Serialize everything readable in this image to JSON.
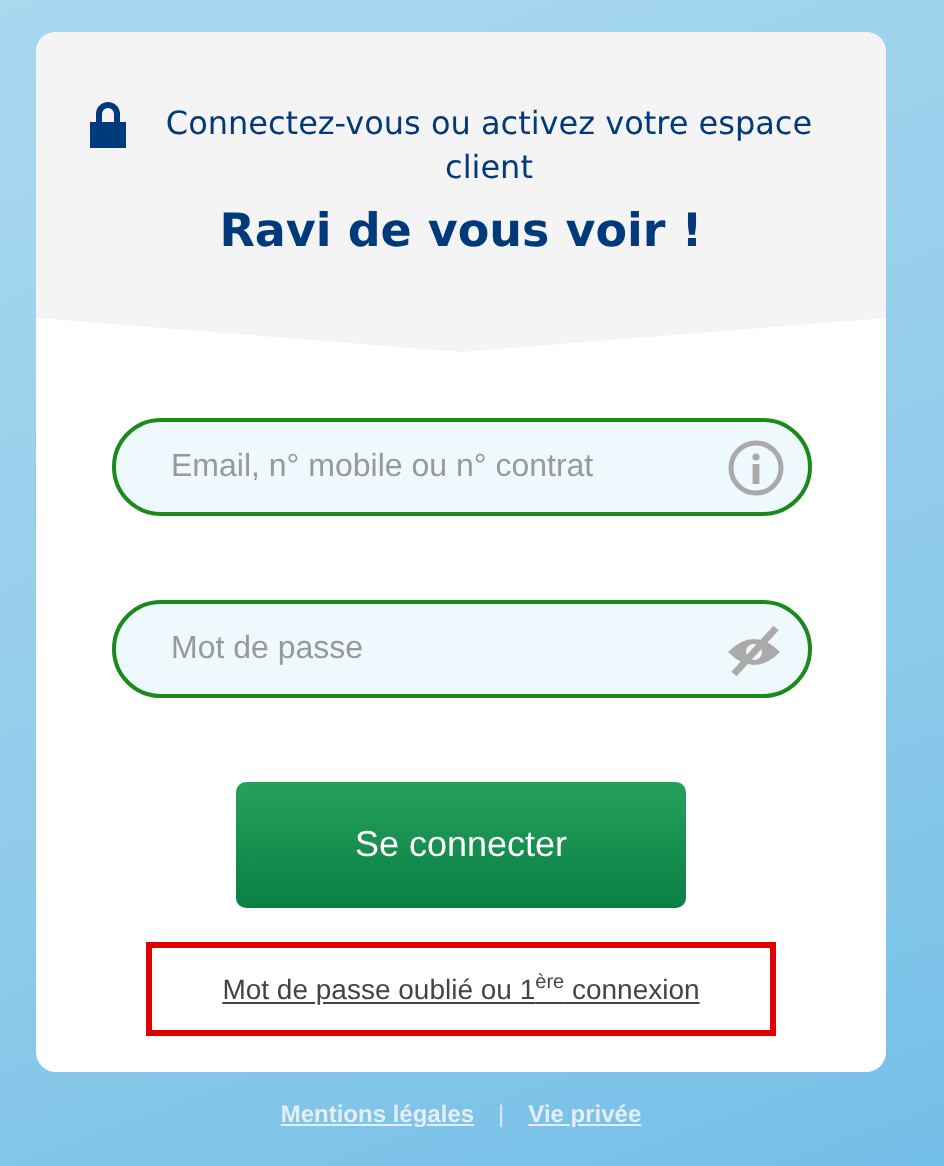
{
  "header": {
    "subtitle": "Connectez-vous ou activez votre espace client",
    "title": "Ravi de vous voir !"
  },
  "fields": [
    {
      "kind": "info",
      "placeholder": "Email, n° mobile ou n° contrat"
    },
    {
      "kind": "password",
      "placeholder": "Mot de passe"
    }
  ],
  "submit_button": "Se connecter",
  "forgot_link": {
    "text": "Mot de passe oublié ou 1$^{ère}$ connexion",
    "highlighted": true
  },
  "footer_links": [
    {
      "label": "Mentions légales"
    },
    {
      "label": "Vie privée"
    }
  ],
  "footer_separator": "|"
}
